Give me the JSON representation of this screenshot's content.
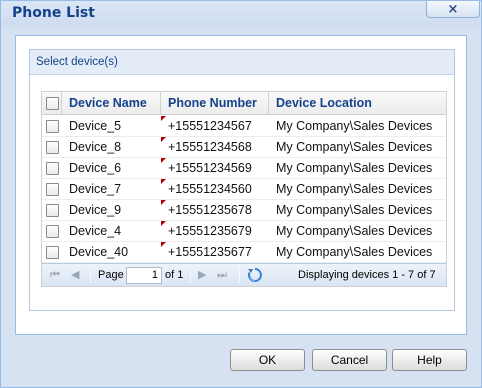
{
  "window": {
    "title": "Phone List",
    "close_label": "×"
  },
  "panel": {
    "title": "Select device(s)"
  },
  "grid": {
    "columns": [
      "Device Name",
      "Phone Number",
      "Device Location"
    ],
    "rows": [
      {
        "name": "Device_5",
        "phone": "+15551234567",
        "location": "My Company\\Sales Devices"
      },
      {
        "name": "Device_8",
        "phone": "+15551234568",
        "location": "My Company\\Sales Devices"
      },
      {
        "name": "Device_6",
        "phone": "+15551234569",
        "location": "My Company\\Sales Devices"
      },
      {
        "name": "Device_7",
        "phone": "+15551234560",
        "location": "My Company\\Sales Devices"
      },
      {
        "name": "Device_9",
        "phone": "+15551235678",
        "location": "My Company\\Sales Devices"
      },
      {
        "name": "Device_4",
        "phone": "+15551235679",
        "location": "My Company\\Sales Devices"
      },
      {
        "name": "Device_40",
        "phone": "+15551235677",
        "location": "My Company\\Sales Devices"
      }
    ]
  },
  "pager": {
    "page_label": "Page",
    "page_value": "1",
    "of_label": "of 1",
    "display_text": "Displaying devices 1 - 7 of 7"
  },
  "buttons": {
    "ok": "OK",
    "cancel": "Cancel",
    "help": "Help"
  }
}
